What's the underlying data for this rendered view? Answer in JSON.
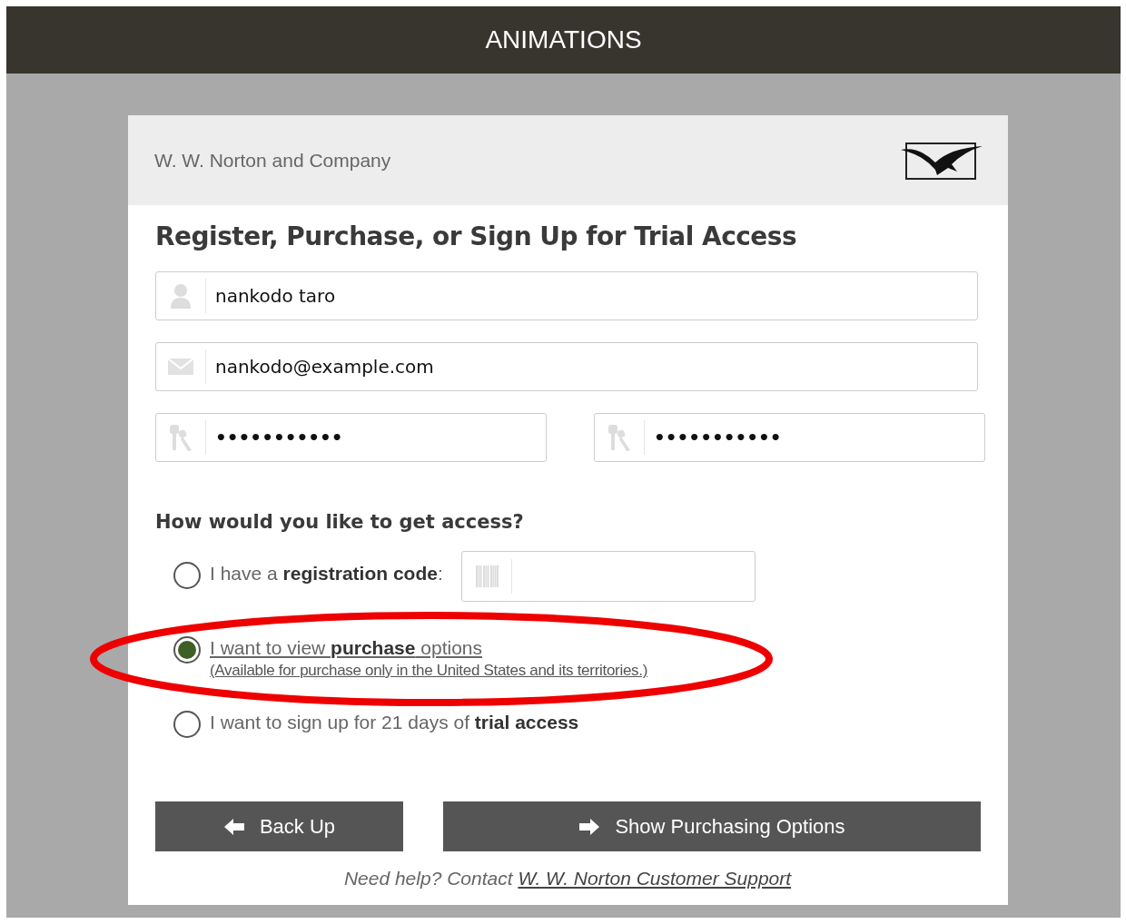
{
  "top_bar": {
    "title": "ANIMATIONS"
  },
  "card_header": {
    "publisher": "W. W. Norton and Company"
  },
  "heading": "Register, Purchase, or Sign Up for Trial Access",
  "fields": [
    {
      "kind": "name",
      "value": "nankodo taro"
    },
    {
      "kind": "email",
      "value": "nankodo@example.com"
    }
  ],
  "password_fields": [
    {
      "value": "•••••••••••"
    },
    {
      "value": "•••••••••••"
    }
  ],
  "access_question": "How would you like to get access?",
  "options": [
    {
      "kind": "code",
      "label": "I have a **registration code**:",
      "selected": false
    },
    {
      "kind": "link",
      "label": "I want to view **purchase** options",
      "note": "(Available for purchase only in the United States and its territories.)",
      "selected": true
    },
    {
      "kind": "plain",
      "label": "I want to sign up for 21 days of **trial access**",
      "selected": false
    }
  ],
  "buttons": [
    {
      "kind": "back",
      "label": "Back Up"
    },
    {
      "kind": "forward",
      "label": "Show Purchasing Options"
    }
  ],
  "help": {
    "text": "Need help? Contact",
    "link": "W. W. Norton Customer Support"
  }
}
